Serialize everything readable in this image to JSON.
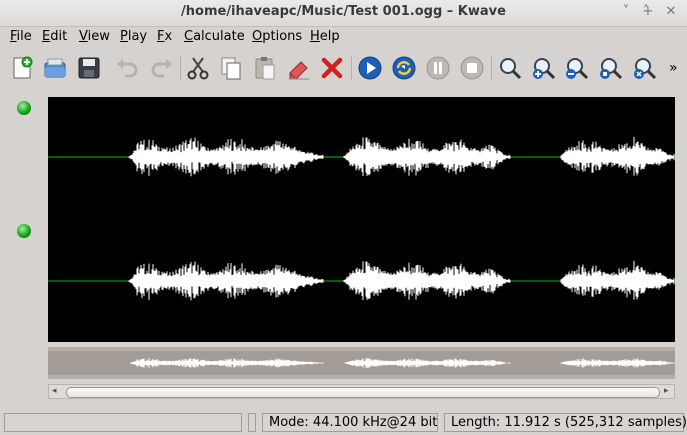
{
  "window": {
    "title": "/home/ihaveapc/Music/Test 001.ogg – Kwave",
    "buttons": [
      "˅",
      "˄",
      "+",
      "✕"
    ]
  },
  "menubar": {
    "items": [
      {
        "label": "File",
        "u": "F",
        "rest": "ile"
      },
      {
        "label": "Edit",
        "u": "E",
        "rest": "dit"
      },
      {
        "label": "View",
        "u": "V",
        "rest": "iew"
      },
      {
        "label": "Play",
        "u": "P",
        "rest": "lay"
      },
      {
        "label": "Fx",
        "u": "F",
        "rest": "x"
      },
      {
        "label": "Calculate",
        "u": "C",
        "rest": "alculate"
      },
      {
        "label": "Options",
        "u": "O",
        "rest": "ptions"
      },
      {
        "label": "Help",
        "u": "H",
        "rest": "elp"
      }
    ]
  },
  "toolbar": {
    "icons": [
      "new-file-icon",
      "open-file-icon",
      "save-icon",
      "undo-icon",
      "redo-icon",
      "cut-icon",
      "copy-icon",
      "paste-icon",
      "erase-icon",
      "delete-icon",
      "play-icon",
      "loop-icon",
      "pause-icon",
      "stop-icon",
      "zoom-icon",
      "zoom-in-icon",
      "zoom-out-icon",
      "zoom-selection-icon",
      "zoom-all-icon"
    ],
    "overflow": "»"
  },
  "scrollbar": {
    "left_arrow": "◂",
    "right_arrow": "▸"
  },
  "statusbar": {
    "message": "",
    "mode": "Mode: 44.100 kHz@24 bit",
    "length": "Length: 11.912 s (525,312 samples)"
  },
  "colors": {
    "wave_bg": "#000000",
    "wave_fg": "#ffffff",
    "zero_line": "#00c000",
    "overview_bg": "#b5aea9"
  }
}
